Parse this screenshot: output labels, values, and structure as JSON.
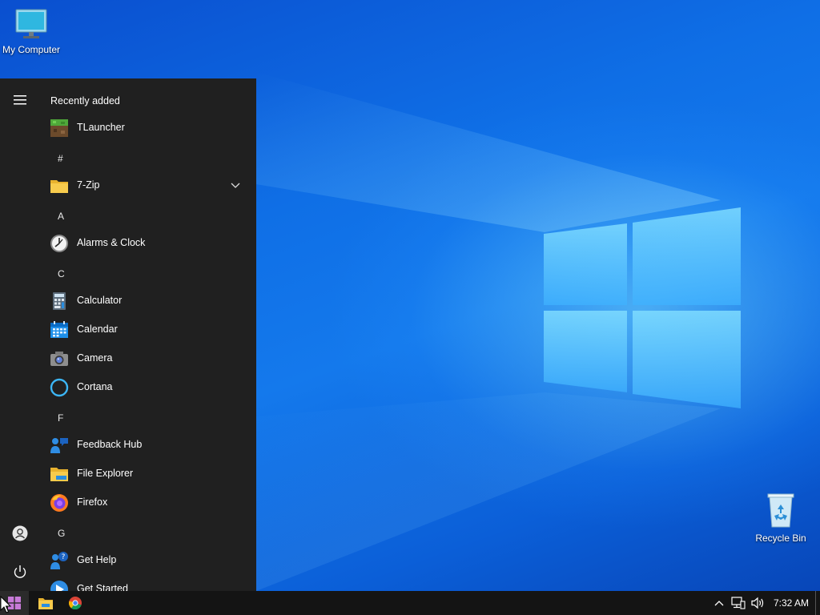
{
  "desktop": {
    "icons": [
      {
        "label": "My Computer"
      },
      {
        "label": "Recycle Bin"
      }
    ]
  },
  "start_menu": {
    "recently_added_label": "Recently added",
    "recently_added": [
      {
        "name": "TLauncher",
        "icon": "tlauncher-icon"
      }
    ],
    "groups": [
      {
        "letter": "#",
        "items": [
          {
            "name": "7-Zip",
            "icon": "folder-icon",
            "expandable": true
          }
        ]
      },
      {
        "letter": "A",
        "items": [
          {
            "name": "Alarms & Clock",
            "icon": "clock-icon"
          }
        ]
      },
      {
        "letter": "C",
        "items": [
          {
            "name": "Calculator",
            "icon": "calculator-icon"
          },
          {
            "name": "Calendar",
            "icon": "calendar-icon"
          },
          {
            "name": "Camera",
            "icon": "camera-icon"
          },
          {
            "name": "Cortana",
            "icon": "cortana-icon"
          }
        ]
      },
      {
        "letter": "F",
        "items": [
          {
            "name": "Feedback Hub",
            "icon": "feedback-hub-icon"
          },
          {
            "name": "File Explorer",
            "icon": "file-explorer-icon"
          },
          {
            "name": "Firefox",
            "icon": "firefox-icon"
          }
        ]
      },
      {
        "letter": "G",
        "items": [
          {
            "name": "Get Help",
            "icon": "get-help-icon"
          },
          {
            "name": "Get Started",
            "icon": "get-started-icon"
          }
        ]
      }
    ],
    "rail": [
      "hamburger-menu-icon",
      "user-account-icon",
      "power-icon"
    ]
  },
  "taskbar": {
    "pinned": [
      "start-button",
      "file-explorer-taskbar",
      "chrome-taskbar"
    ],
    "tray_icons": [
      "chevron-up-icon",
      "network-icon",
      "volume-icon"
    ],
    "clock": "7:32 AM"
  }
}
